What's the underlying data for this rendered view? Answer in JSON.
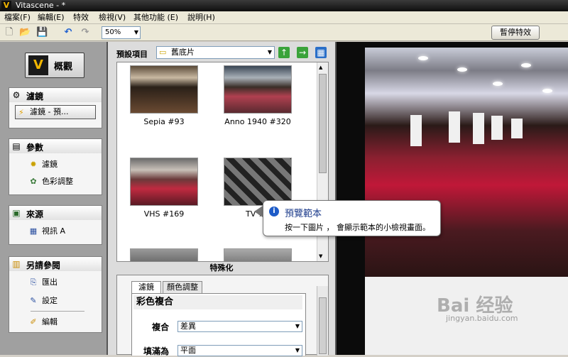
{
  "window": {
    "title": "Vitascene - *",
    "logo": "V"
  },
  "menu": [
    "檔案(F)",
    "編輯(E)",
    "特效",
    "檢視(V)",
    "其他功能 (E)",
    "說明(H)"
  ],
  "toolbar": {
    "zoom": "50%",
    "pause_label": "暫停特效",
    "icons": [
      "new-file-icon",
      "open-folder-icon",
      "save-icon",
      "undo-icon",
      "redo-icon"
    ]
  },
  "left": {
    "overview_label": "概觀",
    "filters": {
      "title": "濾鏡",
      "current": "濾鏡 - 預..."
    },
    "params": {
      "title": "參數",
      "items": [
        "濾鏡",
        "色彩調整"
      ]
    },
    "source": {
      "title": "來源",
      "items": [
        "視訊 A"
      ]
    },
    "see_also": {
      "title": "另請參閱",
      "items": [
        "匯出",
        "設定",
        "編輯"
      ]
    }
  },
  "presets": {
    "label": "預設項目",
    "folder": "舊底片",
    "thumbnails": [
      "Sepia #93",
      "Anno 1940 #320",
      "VHS #169",
      "TV #5"
    ]
  },
  "special": {
    "title": "特殊化",
    "tabs": [
      "濾鏡",
      "顏色調整"
    ],
    "heading": "彩色複合",
    "params": [
      {
        "label": "複合",
        "value": "差異"
      },
      {
        "label": "填滿為",
        "value": "平面"
      }
    ]
  },
  "tooltip": {
    "title": "預覽範本",
    "body": "按一下圖片 ， 會顯示範本的小檢視畫面。"
  },
  "watermark": {
    "main": "Bai 经验",
    "sub": "jingyan.baidu.com"
  }
}
